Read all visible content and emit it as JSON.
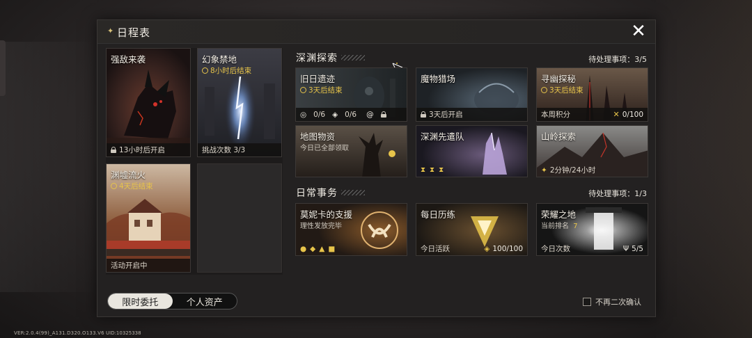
{
  "window": {
    "title": "日程表",
    "close_icon": "close-icon"
  },
  "left_cards": [
    {
      "name": "强敌来袭",
      "footer": "13小时后开启",
      "footer_icon": "lock-icon"
    },
    {
      "name": "幻象禁地",
      "timer": "8小时后结束",
      "footer": "挑战次数 3/3"
    },
    {
      "name": "渊墟流火",
      "timer": "4天后结束",
      "footer": "活动开启中"
    }
  ],
  "abyss": {
    "title": "深渊探索",
    "pending": "待处理事项：3/5",
    "cards": [
      {
        "name": "旧日遗迹",
        "timer": "3天后结束",
        "stats": [
          "0/6",
          "0/6"
        ]
      },
      {
        "name": "魔物猎场",
        "footer": "3天后开启"
      },
      {
        "name": "寻幽探秘",
        "timer": "3天后结束",
        "footer_left": "本周积分",
        "footer_right": "0/100"
      },
      {
        "name": "地图物资",
        "sub": "今日已全部领取"
      },
      {
        "name": "深渊先遣队"
      },
      {
        "name": "山岭探索",
        "footer": "2分钟/24小时"
      }
    ]
  },
  "daily": {
    "title": "日常事务",
    "pending": "待处理事项：1/3",
    "cards": [
      {
        "name": "莫妮卡的支援",
        "sub": "理性发放完毕"
      },
      {
        "name": "每日历练",
        "footer_left": "今日活跃",
        "footer_right": "100/100"
      },
      {
        "name": "荣耀之地",
        "sub_label": "当前排名",
        "sub_value": "7",
        "footer_left": "今日次数",
        "footer_right": "5/5"
      }
    ]
  },
  "tabs": [
    {
      "label": "限时委托",
      "active": true
    },
    {
      "label": "个人资产",
      "active": false
    }
  ],
  "confirm_label": "不再二次确认",
  "version": "VER:2.0.4(99)_A131.D320.O133.V6",
  "uid": "UID:10325338",
  "colors": {
    "accent_gold": "#e7c44a",
    "panel_bg": "#232121"
  }
}
